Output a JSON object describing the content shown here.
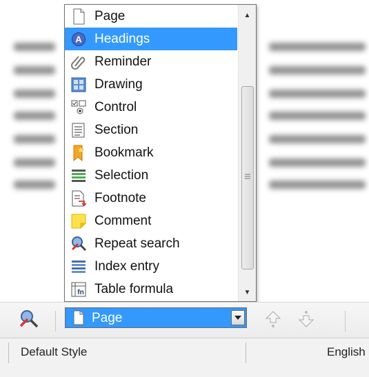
{
  "navigator": {
    "items": [
      {
        "label": "Page",
        "icon": "page-icon"
      },
      {
        "label": "Headings",
        "icon": "headings-icon",
        "selected": true
      },
      {
        "label": "Reminder",
        "icon": "paperclip-icon"
      },
      {
        "label": "Drawing",
        "icon": "drawing-icon"
      },
      {
        "label": "Control",
        "icon": "control-icon"
      },
      {
        "label": "Section",
        "icon": "section-icon"
      },
      {
        "label": "Bookmark",
        "icon": "bookmark-icon"
      },
      {
        "label": "Selection",
        "icon": "selection-icon"
      },
      {
        "label": "Footnote",
        "icon": "footnote-icon"
      },
      {
        "label": "Comment",
        "icon": "comment-icon"
      },
      {
        "label": "Repeat search",
        "icon": "repeat-search-icon"
      },
      {
        "label": "Index entry",
        "icon": "index-entry-icon"
      },
      {
        "label": "Table formula",
        "icon": "table-formula-icon"
      }
    ],
    "combo_value": "Page"
  },
  "statusbar": {
    "style": "Default Style",
    "language": "English"
  },
  "colors": {
    "selection": "#3399ff"
  }
}
